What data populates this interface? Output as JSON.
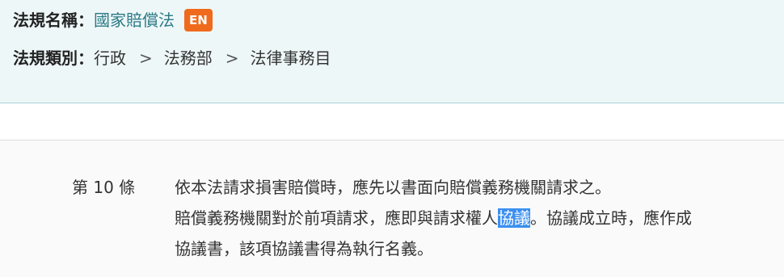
{
  "header": {
    "name_label": "法規名稱：",
    "law_name": "國家賠償法",
    "en_badge": "EN",
    "category_label": "法規類別：",
    "breadcrumb": [
      "行政",
      "法務部",
      "法律事務目"
    ],
    "separator": ">"
  },
  "article": {
    "number": "第 10 條",
    "paragraphs": [
      "依本法請求損害賠償時，應先以書面向賠償義務機關請求之。",
      {
        "before": "賠償義務機關對於前項請求，應即與請求權人",
        "highlight": "協議",
        "after": "。協議成立時，應作成"
      },
      "協議書，該項協議書得為執行名義。"
    ]
  },
  "colors": {
    "header_bg": "#eef7f8",
    "link": "#2b7a86",
    "badge": "#f06a1d",
    "selection": "#3b8ff0"
  }
}
